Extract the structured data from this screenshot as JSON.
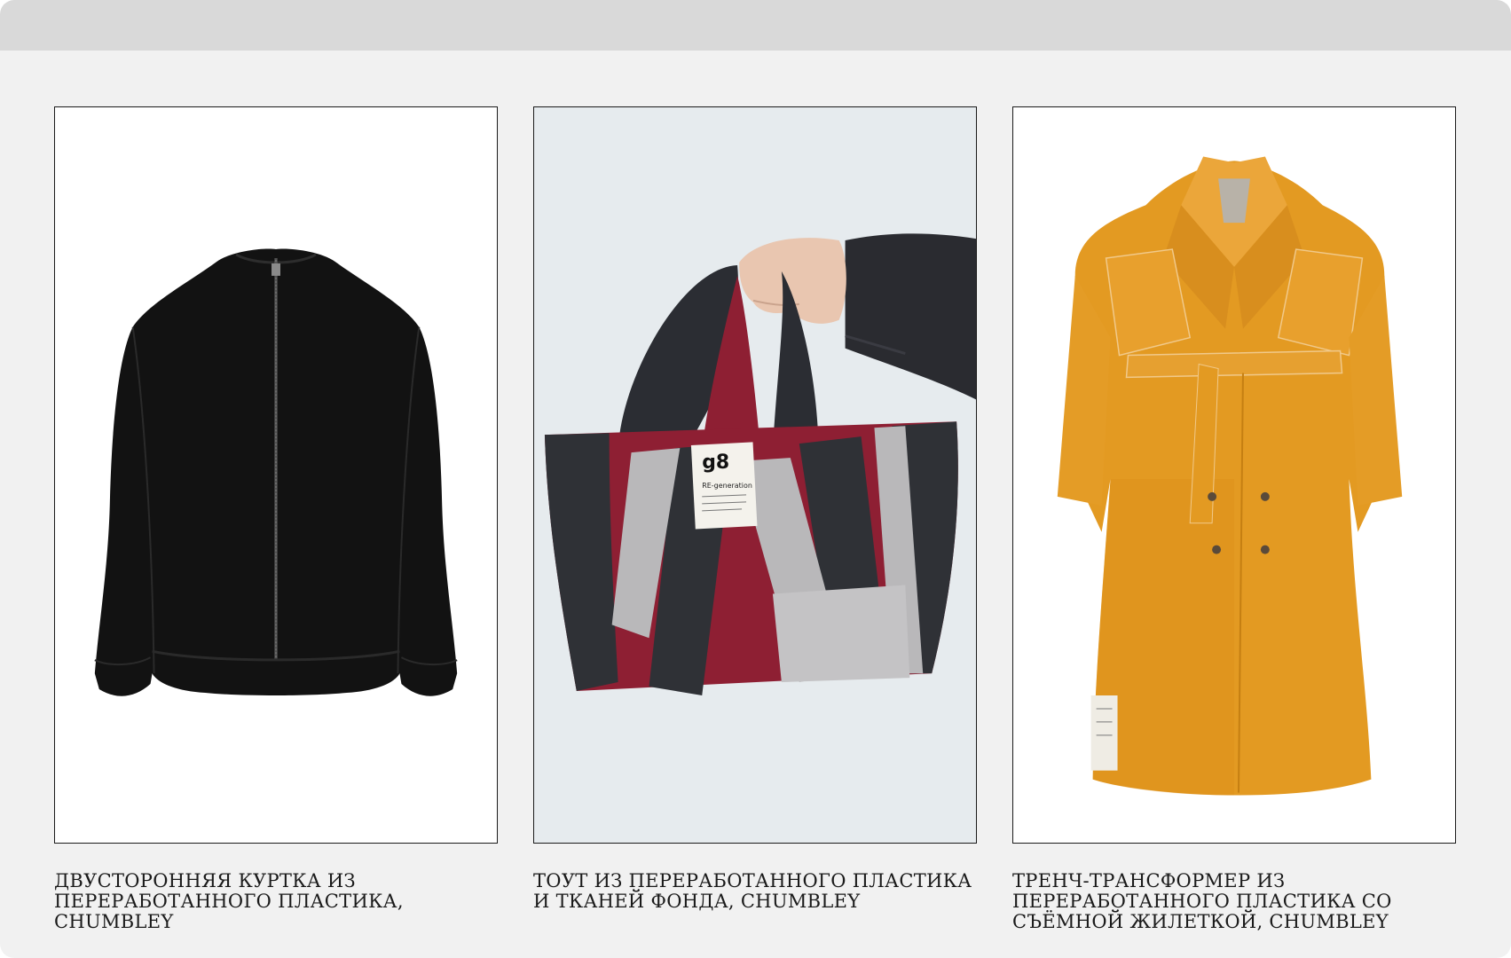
{
  "products": [
    {
      "image_label": "double-sided-jacket-image",
      "caption_lines": [
        "ДВУСТОРОННЯЯ КУРТКА ИЗ",
        "ПЕРЕРАБОТАННОГО ПЛАСТИКА, CHUMBLEY"
      ]
    },
    {
      "image_label": "tote-bag-image",
      "caption_lines": [
        "ТОУТ ИЗ ПЕРЕРАБОТАННОГО ПЛАСТИКА",
        "И ТКАНЕЙ ФОНДА, CHUMBLEY"
      ],
      "tag_text": "RE-generation"
    },
    {
      "image_label": "trench-coat-image",
      "caption_lines": [
        "ТРЕНЧ-ТРАНСФОРМЕР ИЗ",
        "ПЕРЕРАБОТАННОГО ПЛАСТИКА СО",
        "СЪЁМНОЙ ЖИЛЕТКОЙ, CHUMBLEY"
      ]
    }
  ],
  "colors": {
    "page_bg": "#f1f1f1",
    "top_bar": "#d9d9d9",
    "text": "#1a1a1a",
    "jacket": "#111111",
    "bag_red": "#8e1f33",
    "bag_dark": "#33363b",
    "bag_grey": "#b9b8ba",
    "coat": "#e39a22"
  }
}
